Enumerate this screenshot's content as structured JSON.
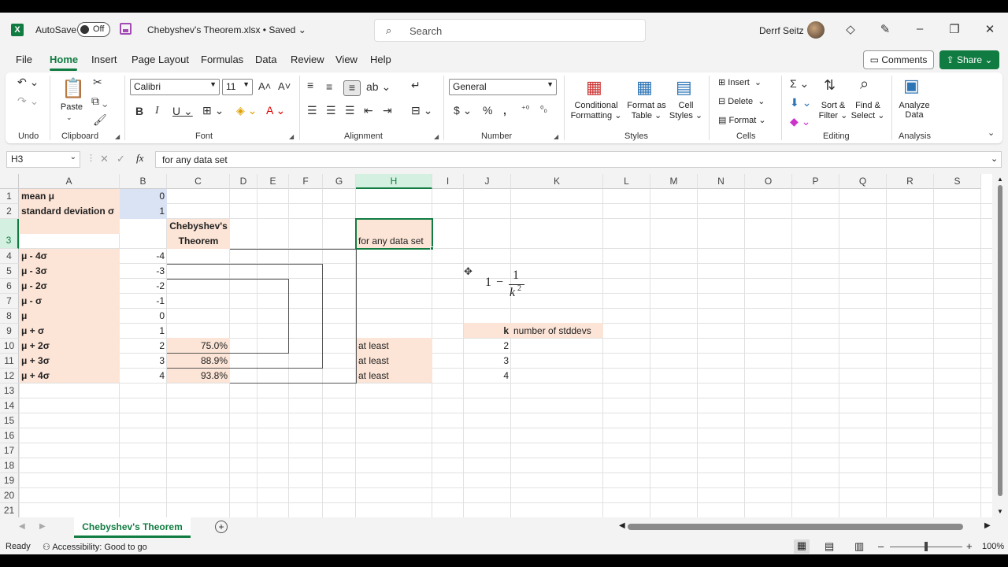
{
  "titlebar": {
    "autosave_label": "AutoSave",
    "autosave_state": "Off",
    "file_title": "Chebyshev's Theorem.xlsx • Saved",
    "search_placeholder": "Search",
    "user_name": "Derrf Seitz"
  },
  "menu": {
    "tabs": [
      "File",
      "Home",
      "Insert",
      "Page Layout",
      "Formulas",
      "Data",
      "Review",
      "View",
      "Help"
    ],
    "comments": "Comments",
    "share": "Share"
  },
  "ribbon": {
    "groups": {
      "undo": "Undo",
      "clipboard": "Clipboard",
      "font": "Font",
      "alignment": "Alignment",
      "number": "Number",
      "styles": "Styles",
      "cells": "Cells",
      "editing": "Editing",
      "analysis": "Analysis"
    },
    "paste": "Paste",
    "font_name": "Calibri",
    "font_size": "11",
    "number_format": "General",
    "cond_format_1": "Conditional",
    "cond_format_2": "Formatting",
    "format_table_1": "Format as",
    "format_table_2": "Table",
    "cell_styles_1": "Cell",
    "cell_styles_2": "Styles",
    "insert": "Insert",
    "delete": "Delete",
    "format": "Format",
    "sort_1": "Sort &",
    "sort_2": "Filter",
    "find_1": "Find &",
    "find_2": "Select",
    "analyze_1": "Analyze",
    "analyze_2": "Data"
  },
  "formula_bar": {
    "name_box": "H3",
    "fx": "fx",
    "content": "for any data set"
  },
  "columns": [
    "A",
    "B",
    "C",
    "D",
    "E",
    "F",
    "G",
    "H",
    "I",
    "J",
    "K",
    "L",
    "M",
    "N",
    "O",
    "P",
    "Q",
    "R",
    "S"
  ],
  "rows": [
    "1",
    "2",
    "3",
    "4",
    "5",
    "6",
    "7",
    "8",
    "9",
    "10",
    "11",
    "12",
    "13",
    "14",
    "15",
    "16",
    "17",
    "18",
    "19",
    "20",
    "21"
  ],
  "cells": {
    "A1": "mean μ",
    "B1": "0",
    "A2": "standard deviation σ",
    "B2": "1",
    "C3a": "Chebyshev's",
    "C3b": "Theorem",
    "H3": "for any data set",
    "A4": "μ - 4σ",
    "B4": "-4",
    "A5": "μ - 3σ",
    "B5": "-3",
    "A6": "μ - 2σ",
    "B6": "-2",
    "A7": "μ - σ",
    "B7": "-1",
    "A8": "μ",
    "B8": "0",
    "A9": "μ + σ",
    "B9": "1",
    "A10": "μ + 2σ",
    "B10": "2",
    "C10": "75.0%",
    "H10": "at least",
    "A11": "μ + 3σ",
    "B11": "3",
    "C11": "88.9%",
    "H11": "at least",
    "A12": "μ + 4σ",
    "B12": "4",
    "C12": "93.8%",
    "H12": "at least",
    "J9": "k",
    "K9": "number of stddevs",
    "J10": "2",
    "J11": "3",
    "J12": "4"
  },
  "formula_image": {
    "one": "1",
    "minus": "−",
    "num": "1",
    "den": "k",
    "exp": "2"
  },
  "sheet_tab": "Chebyshev's Theorem",
  "status": {
    "ready": "Ready",
    "accessibility": "Accessibility: Good to go",
    "zoom": "100%"
  },
  "colors": {
    "accent": "#107c41",
    "peach": "#fce4d6",
    "blue": "#dae3f3"
  }
}
